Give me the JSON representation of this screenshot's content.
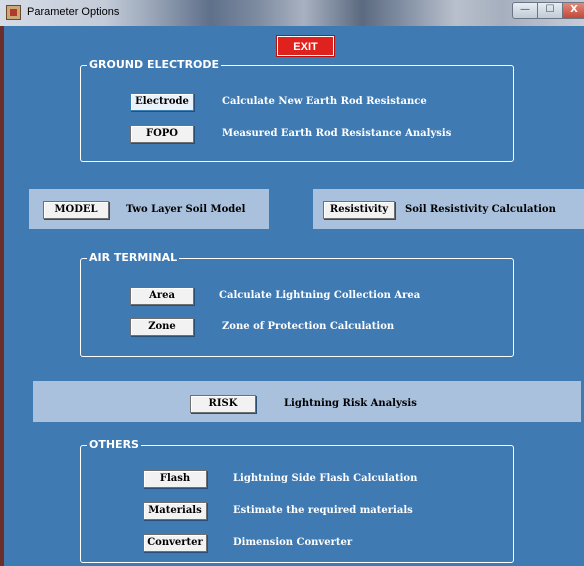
{
  "window": {
    "title": "Parameter Options",
    "controls": {
      "minimize": "—",
      "maximize": "☐",
      "close": "X"
    }
  },
  "exit_label": "EXIT",
  "ground_electrode": {
    "label": "GROUND ELECTRODE",
    "items": [
      {
        "button": "Electrode",
        "description": "Calculate New Earth Rod Resistance"
      },
      {
        "button": "FOPO",
        "description": "Measured Earth Rod Resistance Analysis"
      }
    ]
  },
  "model_panel": {
    "button": "MODEL",
    "description": "Two Layer Soil Model"
  },
  "resistivity_panel": {
    "button": "Resistivity",
    "description": "Soil Resistivity Calculation"
  },
  "air_terminal": {
    "label": "AIR TERMINAL",
    "items": [
      {
        "button": "Area",
        "description": "Calculate Lightning Collection Area"
      },
      {
        "button": "Zone",
        "description": "Zone of Protection Calculation"
      }
    ]
  },
  "risk_panel": {
    "button": "RISK",
    "description": "Lightning Risk Analysis"
  },
  "others": {
    "label": "OTHERS",
    "items": [
      {
        "button": "Flash",
        "description": "Lightning Side Flash Calculation"
      },
      {
        "button": "Materials",
        "description": "Estimate the required materials"
      },
      {
        "button": "Converter",
        "description": "Dimension Converter"
      }
    ]
  },
  "colors": {
    "background": "#3f7ab2",
    "panel": "#a9c1dc",
    "exit": "#e0221f",
    "text_light": "#ffffff"
  }
}
